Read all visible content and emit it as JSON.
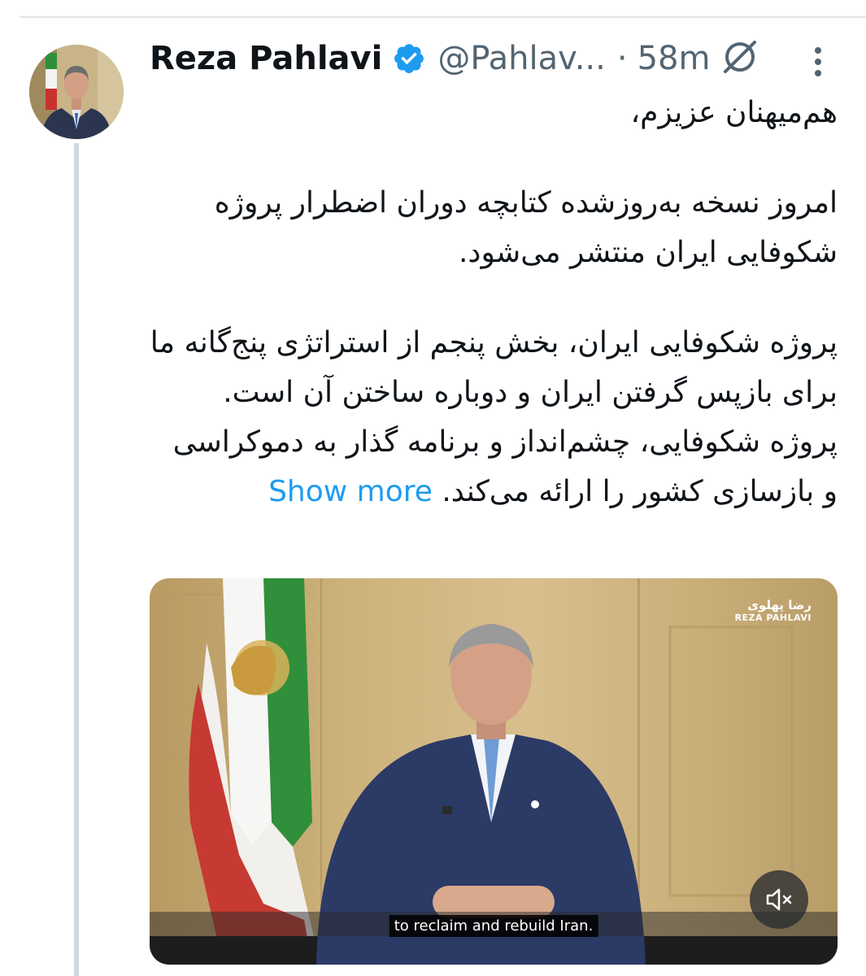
{
  "tweet": {
    "author_name": "Reza Pahlavi",
    "handle": "@Pahlav...",
    "separator": "·",
    "time": "58m",
    "verified": true,
    "paragraphs": [
      "هم‌میهنان عزیزم،",
      "امروز نسخه به‌روزشده کتابچه دوران اضطرار پروژه شکوفایی ایران منتشر می‌شود.",
      "پروژه شکوفایی ایران، بخش پنجم از استراتژی پنج‌گانه ما برای بازپس گرفتن ایران و دوباره ساختن آن است. پروژه شکوفایی، چشم‌انداز و برنامه گذار به دموکراسی و بازسازی کشور را ارائه می‌کند."
    ],
    "show_more_label": "Show more"
  },
  "media": {
    "caption": "to reclaim and rebuild Iran.",
    "watermark_fa": "رضا پهلوی",
    "watermark_en": "REZA PAHLAVI",
    "muted": true
  },
  "colors": {
    "accent": "#1d9bf0",
    "text": "#0f1419",
    "secondary": "#536471",
    "thread_line": "#cfd9de"
  },
  "icons": {
    "verified": "verified-badge-icon",
    "grok": "grok-icon",
    "more": "more-vertical-icon",
    "mute": "volume-muted-icon"
  }
}
